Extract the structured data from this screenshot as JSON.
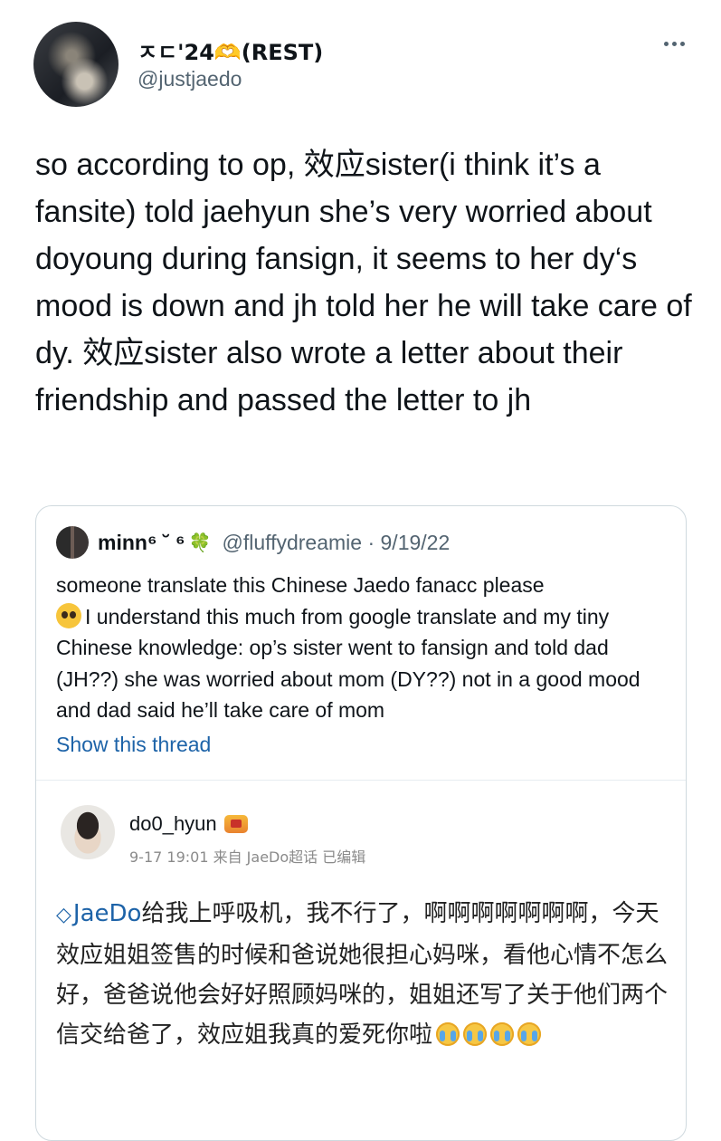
{
  "author": {
    "display_name": "ㅈㄷ'24🫶(REST)",
    "handle": "@justjaedo"
  },
  "tweet": {
    "text": "so according to op, 效应sister(i think it’s a fansite) told jaehyun she’s very worried about doyoung during fansign, it seems to her dy‘s mood is down and jh told her he will take care of dy. 效应sister also wrote a letter about their friendship and passed the letter to jh"
  },
  "quote": {
    "name": "minn⁶ ˘ ⁶",
    "name_icon": "clover-icon",
    "handle_date": "@fluffydreamie · 9/19/22",
    "text_line1": "someone translate this Chinese Jaedo fanacc please",
    "emoji": "pleading-face-icon",
    "text_rest": "I understand this much from google translate and my tiny Chinese knowledge: op’s sister went to fansign and told dad (JH??) she was worried about mom (DY??) not in a good mood and dad said he’ll take care of mom",
    "show_thread": "Show this thread"
  },
  "weibo": {
    "username": "do0_hyun",
    "meta": "9-17 19:01 来自 JaeDo超话 已编辑",
    "tag": "JaeDo",
    "text": "给我上呼吸机，我不行了，啊啊啊啊啊啊啊，今天效应姐姐签售的时候和爸说她很担心妈咪，看他心情不怎么好，爸爸说他会好好照顾妈咪的，姐姐还写了关于他们两个信交给爸了，效应姐我真的爱死你啦"
  }
}
